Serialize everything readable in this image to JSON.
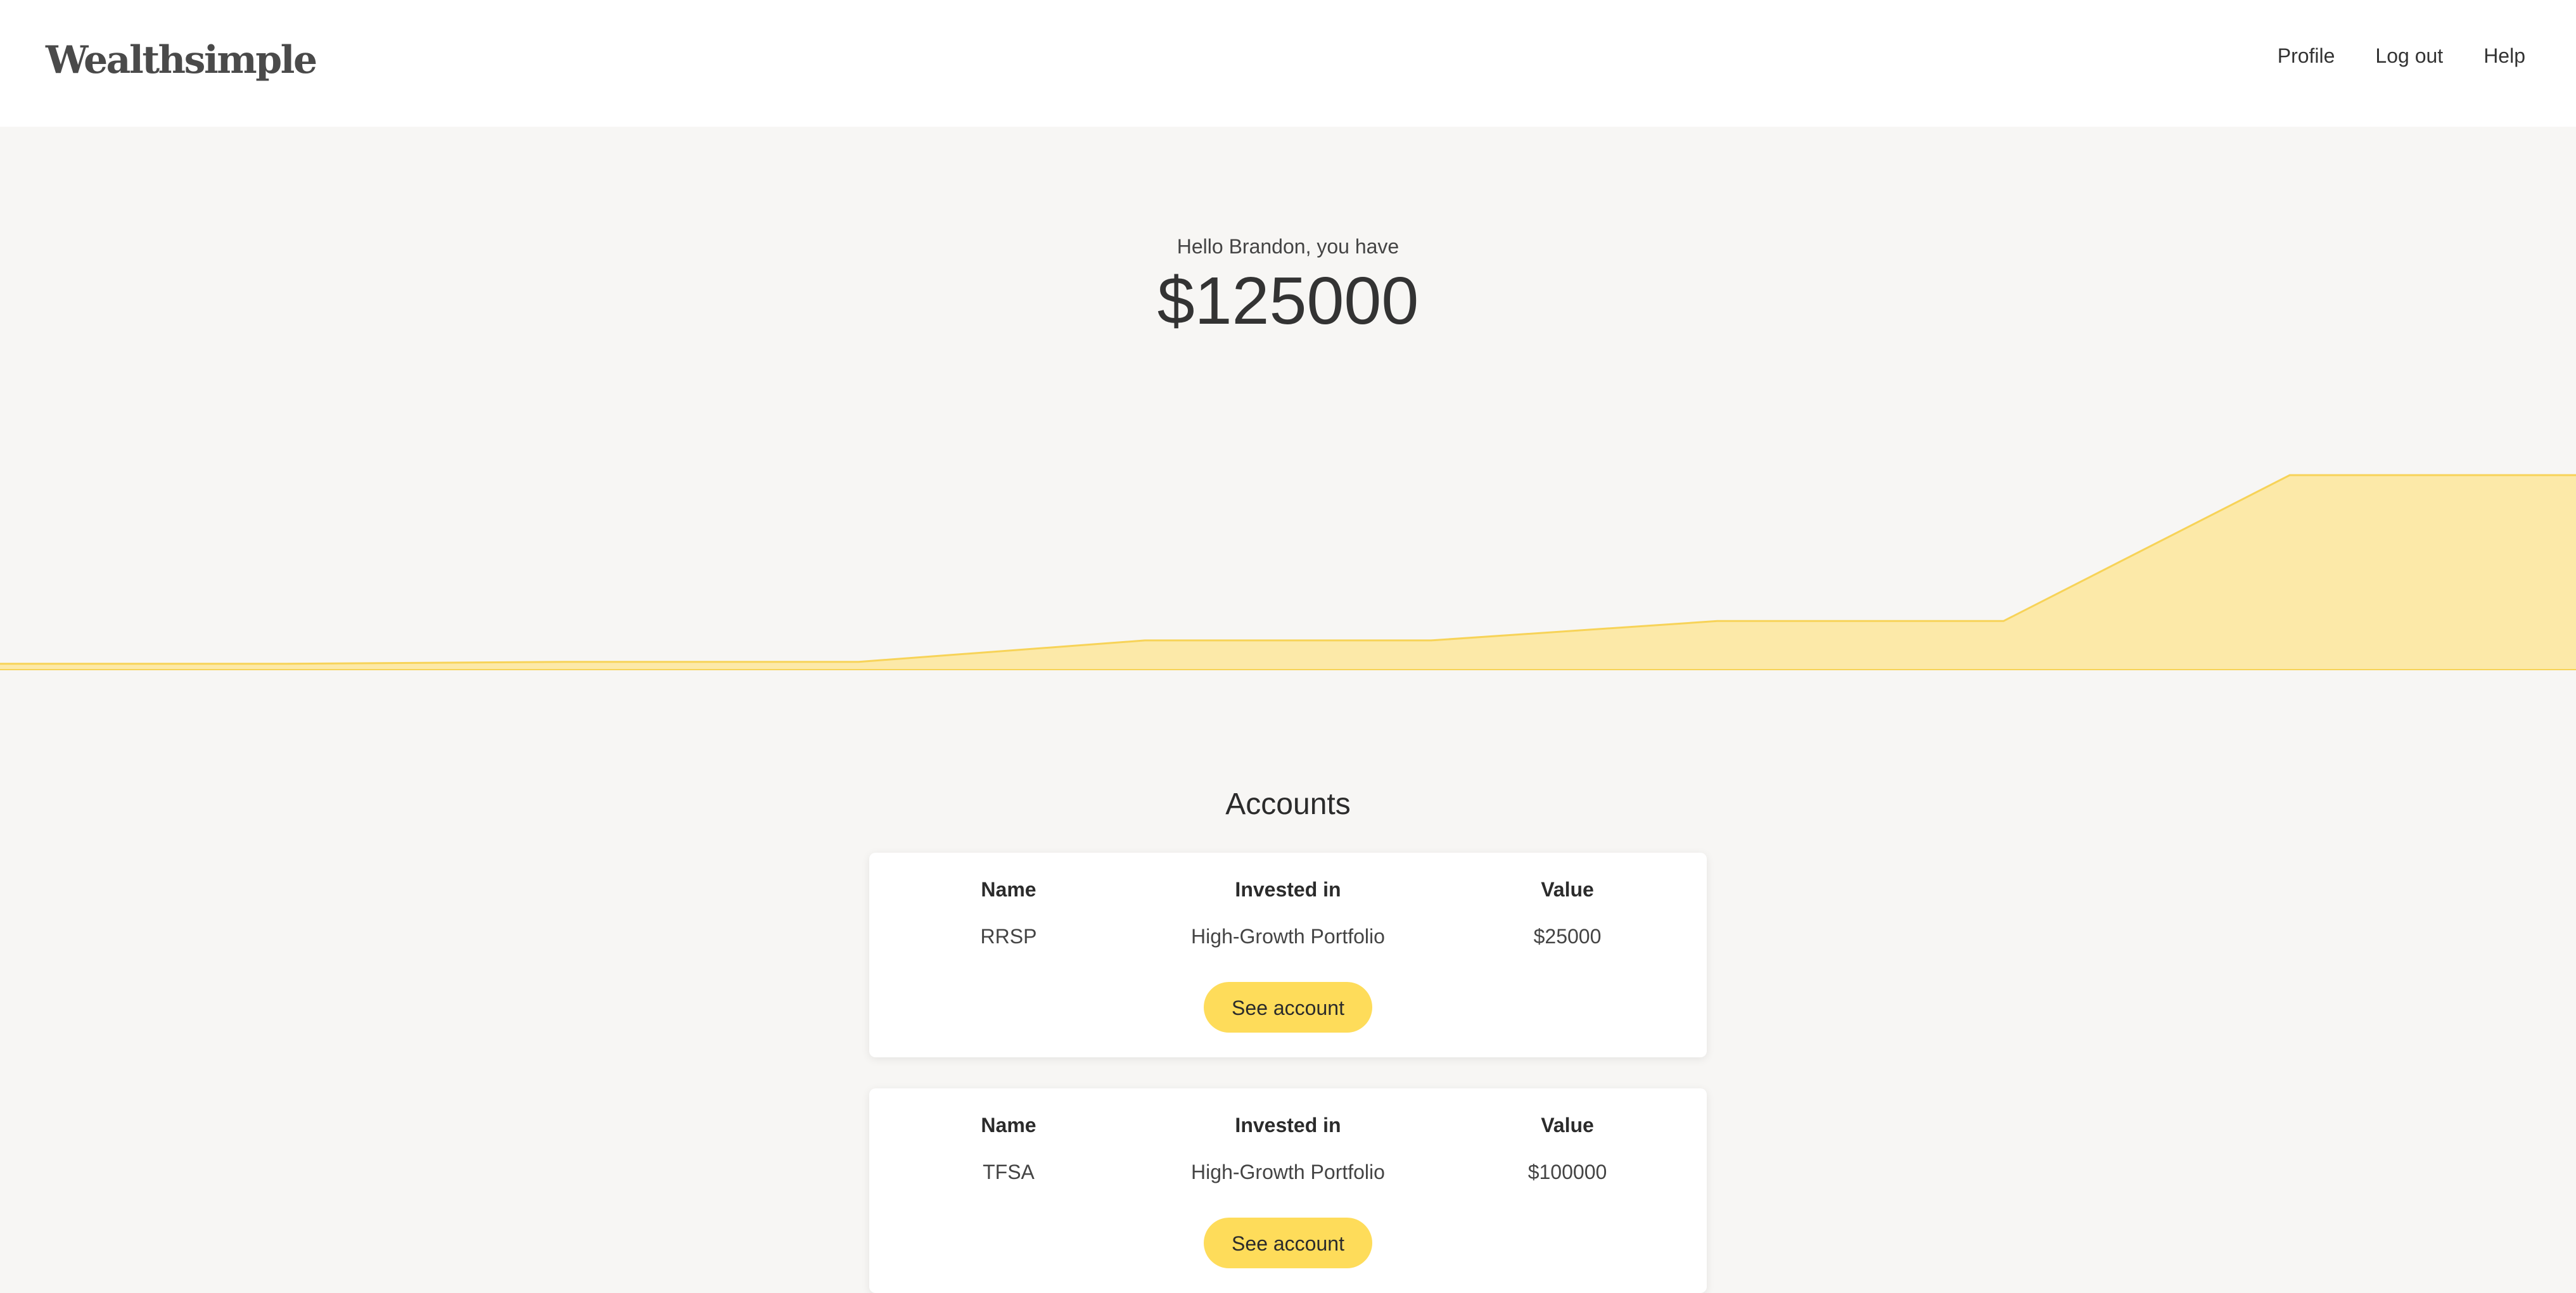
{
  "header": {
    "logo": "Wealthsimple",
    "nav": [
      "Profile",
      "Log out",
      "Help"
    ]
  },
  "hero": {
    "greeting": "Hello Brandon, you have",
    "total": "$125000"
  },
  "colors": {
    "accent": "#fedc5a",
    "chart_fill": "#fce9a8",
    "chart_line": "#f7d358",
    "background": "#f7f6f4"
  },
  "chart_data": {
    "type": "area",
    "x": [
      0,
      1,
      2,
      3,
      4,
      5,
      6,
      7,
      8,
      9
    ],
    "values": [
      3,
      3,
      4,
      4,
      15,
      15,
      25,
      25,
      100,
      100
    ],
    "grid": false,
    "legend": "none"
  },
  "accounts": {
    "title": "Accounts",
    "headers": {
      "name": "Name",
      "invested": "Invested in",
      "value": "Value"
    },
    "items": [
      {
        "name": "RRSP",
        "invested": "High-Growth Portfolio",
        "value": "$25000",
        "button": "See account"
      },
      {
        "name": "TFSA",
        "invested": "High-Growth Portfolio",
        "value": "$100000",
        "button": "See account"
      }
    ]
  }
}
